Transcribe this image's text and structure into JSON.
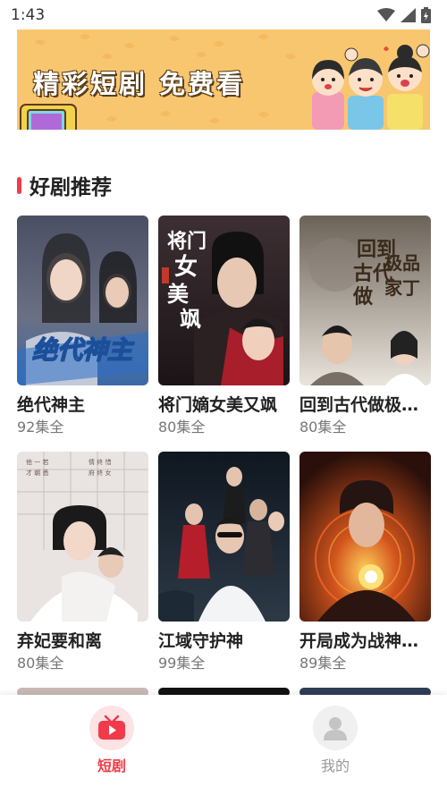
{
  "status_bar": {
    "time": "1:43"
  },
  "banner": {
    "text": "精彩短剧  免费看"
  },
  "section": {
    "title": "好剧推荐"
  },
  "dramas": [
    {
      "title": "绝代神主",
      "episodes": "92集全",
      "poster_text": "绝代神主"
    },
    {
      "title": "将门嫡女美又飒",
      "episodes": "80集全",
      "poster_text": "将门嫡女美又飒"
    },
    {
      "title": "回到古代做极品家丁",
      "episodes": "80集全",
      "poster_text": "回到古代做极品家丁"
    },
    {
      "title": "弃妃要和离",
      "episodes": "80集全"
    },
    {
      "title": "江域守护神",
      "episodes": "99集全"
    },
    {
      "title": "开局成为战神殿主",
      "episodes": "89集全"
    }
  ],
  "nav": {
    "items": [
      {
        "label": "短剧",
        "active": true
      },
      {
        "label": "我的",
        "active": false
      }
    ]
  },
  "colors": {
    "accent": "#f23a4a",
    "banner_bg": "#f8c66f"
  }
}
